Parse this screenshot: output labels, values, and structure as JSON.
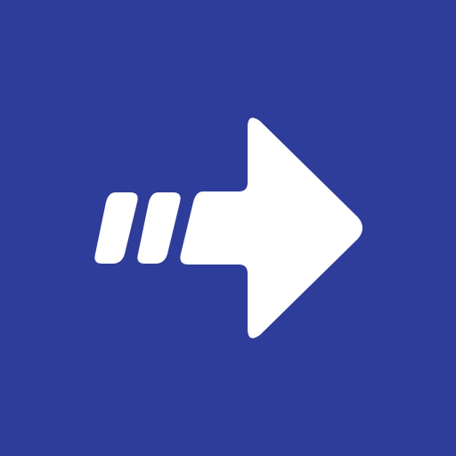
{
  "app_icon": {
    "icon_name": "forward-arrow-icon",
    "background_color": "#2f3d9a",
    "foreground_color": "#ffffff",
    "speed_line_count": 2
  }
}
